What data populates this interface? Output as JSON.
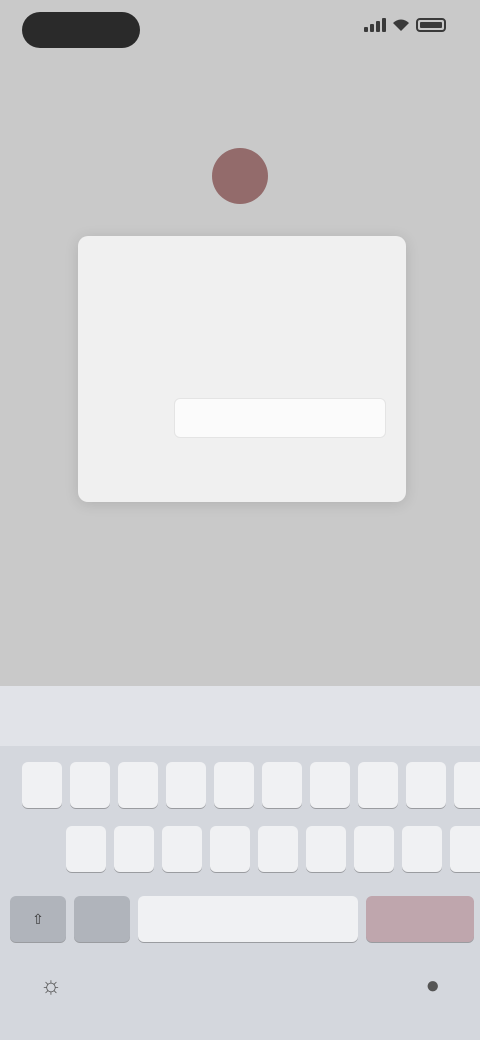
{
  "status_bar": {
    "time": "",
    "battery_level": 1.0
  },
  "nav": {
    "back_label": "",
    "title": "",
    "action_label": ""
  },
  "profile": {
    "line": ""
  },
  "labels": {
    "left": "",
    "right": "",
    "below_dialog": ""
  },
  "dialog": {
    "title": "",
    "message": "",
    "input_label": "",
    "input_value": "",
    "input_placeholder": "",
    "confirm_label": ""
  },
  "keyboard": {
    "suggestions": [
      "",
      "",
      ""
    ],
    "row1": [
      "",
      "",
      "",
      "",
      "",
      "",
      "",
      "",
      "",
      ""
    ],
    "row2": [
      "",
      "",
      "",
      "",
      "",
      "",
      "",
      "",
      ""
    ],
    "shift_icon": "shift-icon",
    "space_label": "",
    "action_label": ""
  },
  "colors": {
    "accent": "#b07a5a",
    "overlay": "#c9c9c9",
    "dialog_bg": "#f0f0f0",
    "keyboard_bg": "#d4d7dd"
  }
}
